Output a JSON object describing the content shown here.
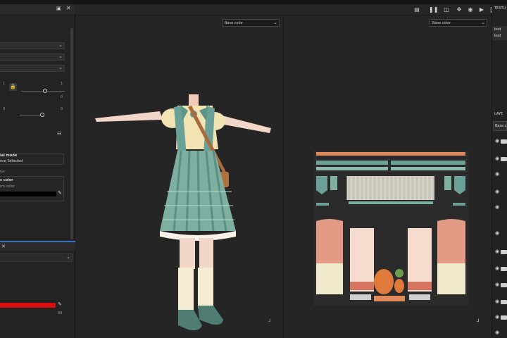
{
  "viewport3d": {
    "channel_select": "Base color"
  },
  "viewport2d": {
    "channel_select": "Base color"
  },
  "left_panel": {
    "slider_row1": {
      "min": "1",
      "max": "1",
      "value": "0"
    },
    "slider_row2": {
      "left": "0",
      "value": "0"
    },
    "mode_box": {
      "title": "ial mode",
      "subtitle": "nce Selected"
    },
    "label_gv": "Gv",
    "color_box": {
      "title": "c color",
      "subtitle": "rm color"
    },
    "base_color_value": "#000000",
    "lower_color_value": "#d90f0f",
    "lower_number": "99"
  },
  "right_panel": {
    "title": "TEXTU",
    "items": [
      "bod",
      "bod"
    ],
    "layers_title": "LAYE",
    "layers_select": "Base c"
  },
  "colors": {
    "accent_blue": "#3a70c0",
    "lower_color": "#d90f0f"
  }
}
